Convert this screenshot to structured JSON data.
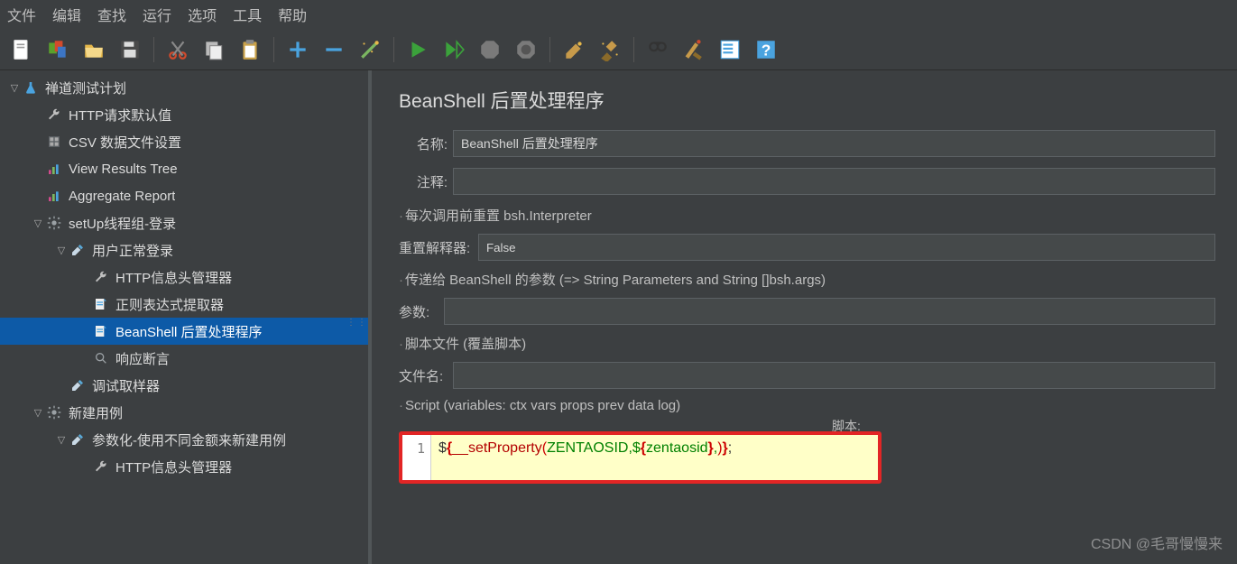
{
  "menu": [
    "文件",
    "编辑",
    "查找",
    "运行",
    "选项",
    "工具",
    "帮助"
  ],
  "toolbar_icons": [
    "new-file-icon",
    "templates-icon",
    "open-icon",
    "save-icon",
    "sep",
    "cut-icon",
    "copy-icon",
    "paste-icon",
    "sep",
    "plus-icon",
    "minus-icon",
    "wand-icon",
    "sep",
    "run-icon",
    "run-next-icon",
    "stop-icon",
    "shutdown-icon",
    "sep",
    "clear-icon",
    "broom-icon",
    "sep",
    "search-icon",
    "reset-icon",
    "list-icon",
    "help-icon"
  ],
  "tree": [
    {
      "level": 0,
      "arrow": "down",
      "icon": "flask",
      "label": "禅道测试计划",
      "sel": false,
      "name": "tree-plan"
    },
    {
      "level": 1,
      "arrow": "",
      "icon": "wrench",
      "label": "HTTP请求默认值",
      "sel": false,
      "name": "tree-http-defaults"
    },
    {
      "level": 1,
      "arrow": "",
      "icon": "csv",
      "label": "CSV 数据文件设置",
      "sel": false,
      "name": "tree-csv-config"
    },
    {
      "level": 1,
      "arrow": "",
      "icon": "chart",
      "label": "View Results Tree",
      "sel": false,
      "name": "tree-results-tree"
    },
    {
      "level": 1,
      "arrow": "",
      "icon": "chart",
      "label": "Aggregate Report",
      "sel": false,
      "name": "tree-aggregate"
    },
    {
      "level": 1,
      "arrow": "down",
      "icon": "gear",
      "label": "setUp线程组-登录",
      "sel": false,
      "name": "tree-setup-group"
    },
    {
      "level": 2,
      "arrow": "down",
      "icon": "dropper",
      "label": "用户正常登录",
      "sel": false,
      "name": "tree-login"
    },
    {
      "level": 3,
      "arrow": "",
      "icon": "wrench",
      "label": "HTTP信息头管理器",
      "sel": false,
      "name": "tree-header-mgr-1"
    },
    {
      "level": 3,
      "arrow": "",
      "icon": "regex",
      "label": "正则表达式提取器",
      "sel": false,
      "name": "tree-regex"
    },
    {
      "level": 3,
      "arrow": "",
      "icon": "regex",
      "label": "BeanShell 后置处理程序",
      "sel": true,
      "name": "tree-beanshell"
    },
    {
      "level": 3,
      "arrow": "",
      "icon": "assert",
      "label": "响应断言",
      "sel": false,
      "name": "tree-assert"
    },
    {
      "level": 2,
      "arrow": "",
      "icon": "dropper",
      "label": "调试取样器",
      "sel": false,
      "name": "tree-debug"
    },
    {
      "level": 1,
      "arrow": "down",
      "icon": "gear",
      "label": "新建用例",
      "sel": false,
      "name": "tree-new-case"
    },
    {
      "level": 2,
      "arrow": "down",
      "icon": "dropper",
      "label": "参数化-使用不同金额来新建用例",
      "sel": false,
      "name": "tree-param"
    },
    {
      "level": 3,
      "arrow": "",
      "icon": "wrench",
      "label": "HTTP信息头管理器",
      "sel": false,
      "name": "tree-header-mgr-2"
    }
  ],
  "panel": {
    "title": "BeanShell 后置处理程序",
    "name_label": "名称:",
    "name_value": "BeanShell 后置处理程序",
    "note_label": "注释:",
    "note_value": "",
    "reset_section": "每次调用前重置 bsh.Interpreter",
    "reset_label": "重置解释器:",
    "reset_value": "False",
    "args_section": "传递给 BeanShell 的参数 (=> String Parameters and String []bsh.args)",
    "args_label": "参数:",
    "args_value": "",
    "file_section": "脚本文件 (覆盖脚本)",
    "file_label": "文件名:",
    "file_value": "",
    "script_section": "Script (variables: ctx vars props prev data log)",
    "script_small": "脚本:",
    "code_line_num": "1",
    "code": {
      "p1": "$",
      "p2": "{",
      "p3": "__setProperty",
      "p4": "(",
      "p5": "ZENTAOSID,$",
      "p6": "{",
      "p7": "zentaosid",
      "p8": "}",
      "p9": ",",
      "p10": ")",
      "p11": "}",
      "p12": ";"
    }
  },
  "watermark": "CSDN @毛哥慢慢来"
}
